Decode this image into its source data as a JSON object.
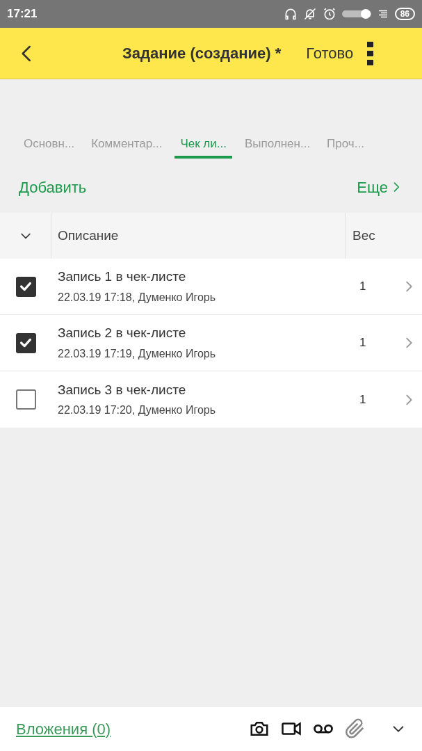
{
  "status_bar": {
    "time": "17:21",
    "battery": "86"
  },
  "header": {
    "title": "Задание (создание) *",
    "action": "Готово"
  },
  "tabs": [
    {
      "label": "Основн...",
      "selected": false
    },
    {
      "label": "Комментар...",
      "selected": false
    },
    {
      "label": "Чек ли...",
      "selected": true
    },
    {
      "label": "Выполнен...",
      "selected": false
    },
    {
      "label": "Проч...",
      "selected": false
    }
  ],
  "toolbar": {
    "add": "Добавить",
    "more": "Еще"
  },
  "table": {
    "columns": [
      "Описание",
      "Вес"
    ],
    "rows": [
      {
        "title": "Запись 1 в чек-листе",
        "subtitle": "22.03.19 17:18, Думенко Игорь",
        "weight": "1",
        "checked": true
      },
      {
        "title": "Запись 2 в чек-листе",
        "subtitle": "22.03.19 17:19, Думенко Игорь",
        "weight": "1",
        "checked": true
      },
      {
        "title": "Запись 3 в чек-листе",
        "subtitle": "22.03.19 17:20, Думенко Игорь",
        "weight": "1",
        "checked": false
      }
    ]
  },
  "footer": {
    "attachments": "Вложения (0)"
  }
}
